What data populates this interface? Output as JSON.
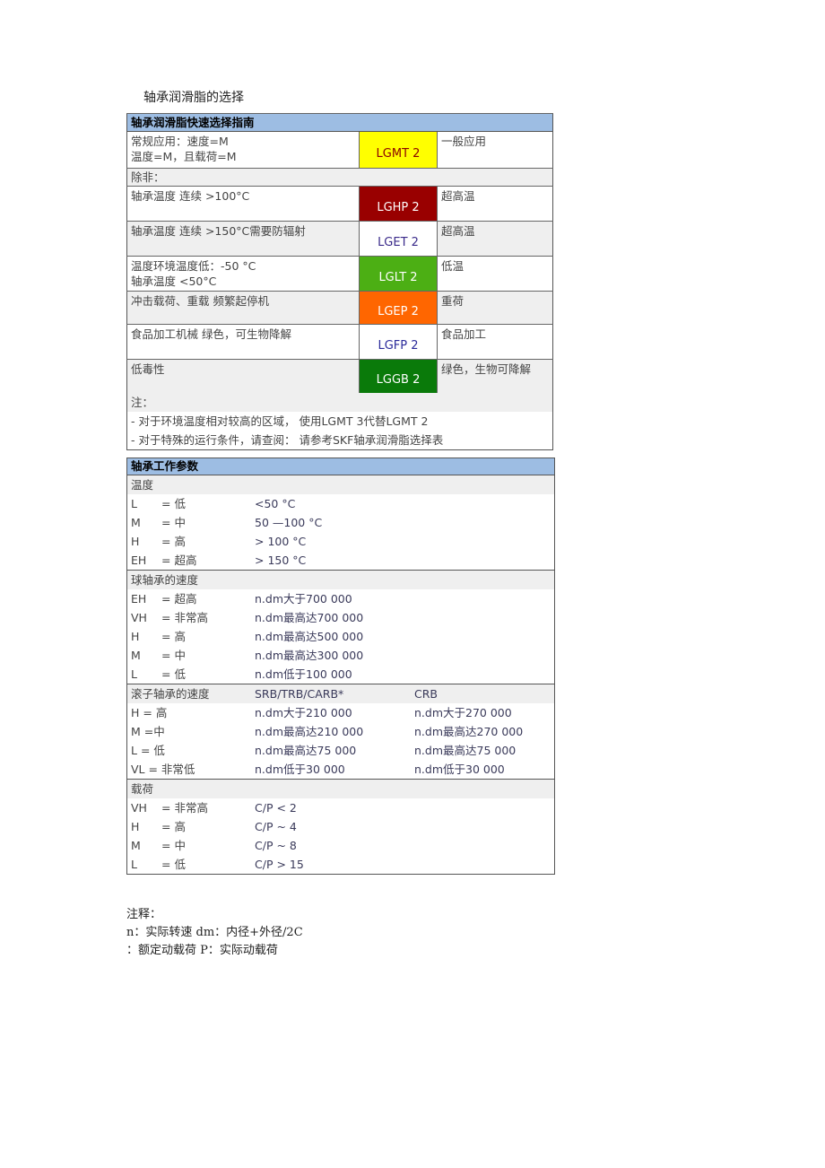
{
  "title": "轴承润滑脂的选择",
  "guide": {
    "header": "轴承润滑脂快速选择指南",
    "rows": [
      {
        "condition_lines": [
          "常规应用：速度=M",
          "温度=M，且载荷=M"
        ],
        "grease": "LGMT 2",
        "bg": "#ffff00",
        "fg": "#8b0000",
        "use": "一般应用"
      },
      {
        "unless": "除非："
      },
      {
        "condition_lines": [
          "轴承温度 连续 >100°C"
        ],
        "grease": "LGHP 2",
        "bg": "#990000",
        "fg": "#ffffff",
        "use": "超高温"
      },
      {
        "condition_lines": [
          "轴承温度 连续 >150°C需要防辐射"
        ],
        "grease": "LGET 2",
        "bg": "#ffffff",
        "fg": "#3a2a8a",
        "use": "超高温"
      },
      {
        "condition_lines": [
          "温度环境温度低：-50 °C",
          "轴承温度 <50°C"
        ],
        "grease": "LGLT 2",
        "bg": "#4caf14",
        "fg": "#ffffff",
        "use": "低温"
      },
      {
        "condition_lines": [
          "冲击载荷、重载 频繁起停机"
        ],
        "grease": "LGEP 2",
        "bg": "#ff6600",
        "fg": "#ffffff",
        "use": "重荷"
      },
      {
        "condition_lines": [
          "食品加工机械 绿色，可生物降解"
        ],
        "grease": "LGFP 2",
        "bg": "#ffffff",
        "fg": "#2a2a9a",
        "use": "食品加工"
      },
      {
        "condition_lines": [
          "低毒性"
        ],
        "grease": "LGGB 2",
        "bg": "#0a7a0a",
        "fg": "#ffffff",
        "use": "绿色，生物可降解"
      }
    ],
    "notes_label": "注：",
    "notes": [
      "- 对于环境温度相对较高的区域， 使用LGMT 3代替LGMT 2",
      "- 对于特殊的运行条件，请查阅： 请参考SKF轴承润滑脂选择表"
    ]
  },
  "params": {
    "header": "轴承工作参数",
    "temperature": {
      "label": "温度",
      "rows": [
        {
          "k": "L",
          "eq": "= 低",
          "v": "<50 °C"
        },
        {
          "k": "M",
          "eq": "= 中",
          "v": "50 —100 °C"
        },
        {
          "k": "H",
          "eq": "= 高",
          "v": "> 100 °C"
        },
        {
          "k": "EH",
          "eq": "= 超高",
          "v": "> 150 °C"
        }
      ]
    },
    "ball_speed": {
      "label": "球轴承的速度",
      "rows": [
        {
          "k": "EH",
          "eq": "= 超高",
          "v": "n.dm大于700 000"
        },
        {
          "k": "VH",
          "eq": "= 非常高",
          "v": "n.dm最高达700 000"
        },
        {
          "k": "H",
          "eq": "= 高",
          "v": "n.dm最高达500 000"
        },
        {
          "k": "M",
          "eq": "= 中",
          "v": "n.dm最高达300 000"
        },
        {
          "k": "L",
          "eq": "= 低",
          "v": "n.dm低于100 000"
        }
      ]
    },
    "roller_speed": {
      "label": "滚子轴承的速度",
      "col1": "SRB/TRB/CARB*",
      "col2": "CRB",
      "rows": [
        {
          "k": "H = 高",
          "v1": "n.dm大于210 000",
          "v2": "n.dm大于270 000"
        },
        {
          "k": "M =中",
          "v1": "n.dm最高达210 000",
          "v2": "n.dm最高达270 000"
        },
        {
          "k": "L = 低",
          "v1": "n.dm最高达75 000",
          "v2": "n.dm最高达75 000"
        },
        {
          "k": "VL = 非常低",
          "v1": "n.dm低于30 000",
          "v2": "n.dm低于30 000"
        }
      ]
    },
    "load": {
      "label": "载荷",
      "rows": [
        {
          "k": "VH",
          "eq": "= 非常高",
          "v": "C/P < 2"
        },
        {
          "k": "H",
          "eq": "= 高",
          "v": "C/P ~ 4"
        },
        {
          "k": "M",
          "eq": "= 中",
          "v": "C/P ~ 8"
        },
        {
          "k": "L",
          "eq": "= 低",
          "v": "C/P > 15"
        }
      ]
    }
  },
  "footnotes": {
    "label": "注释：",
    "lines": [
      "n：实际转速  dm：内径+外径/2C",
      "：额定动载荷  P：实际动载荷"
    ]
  }
}
